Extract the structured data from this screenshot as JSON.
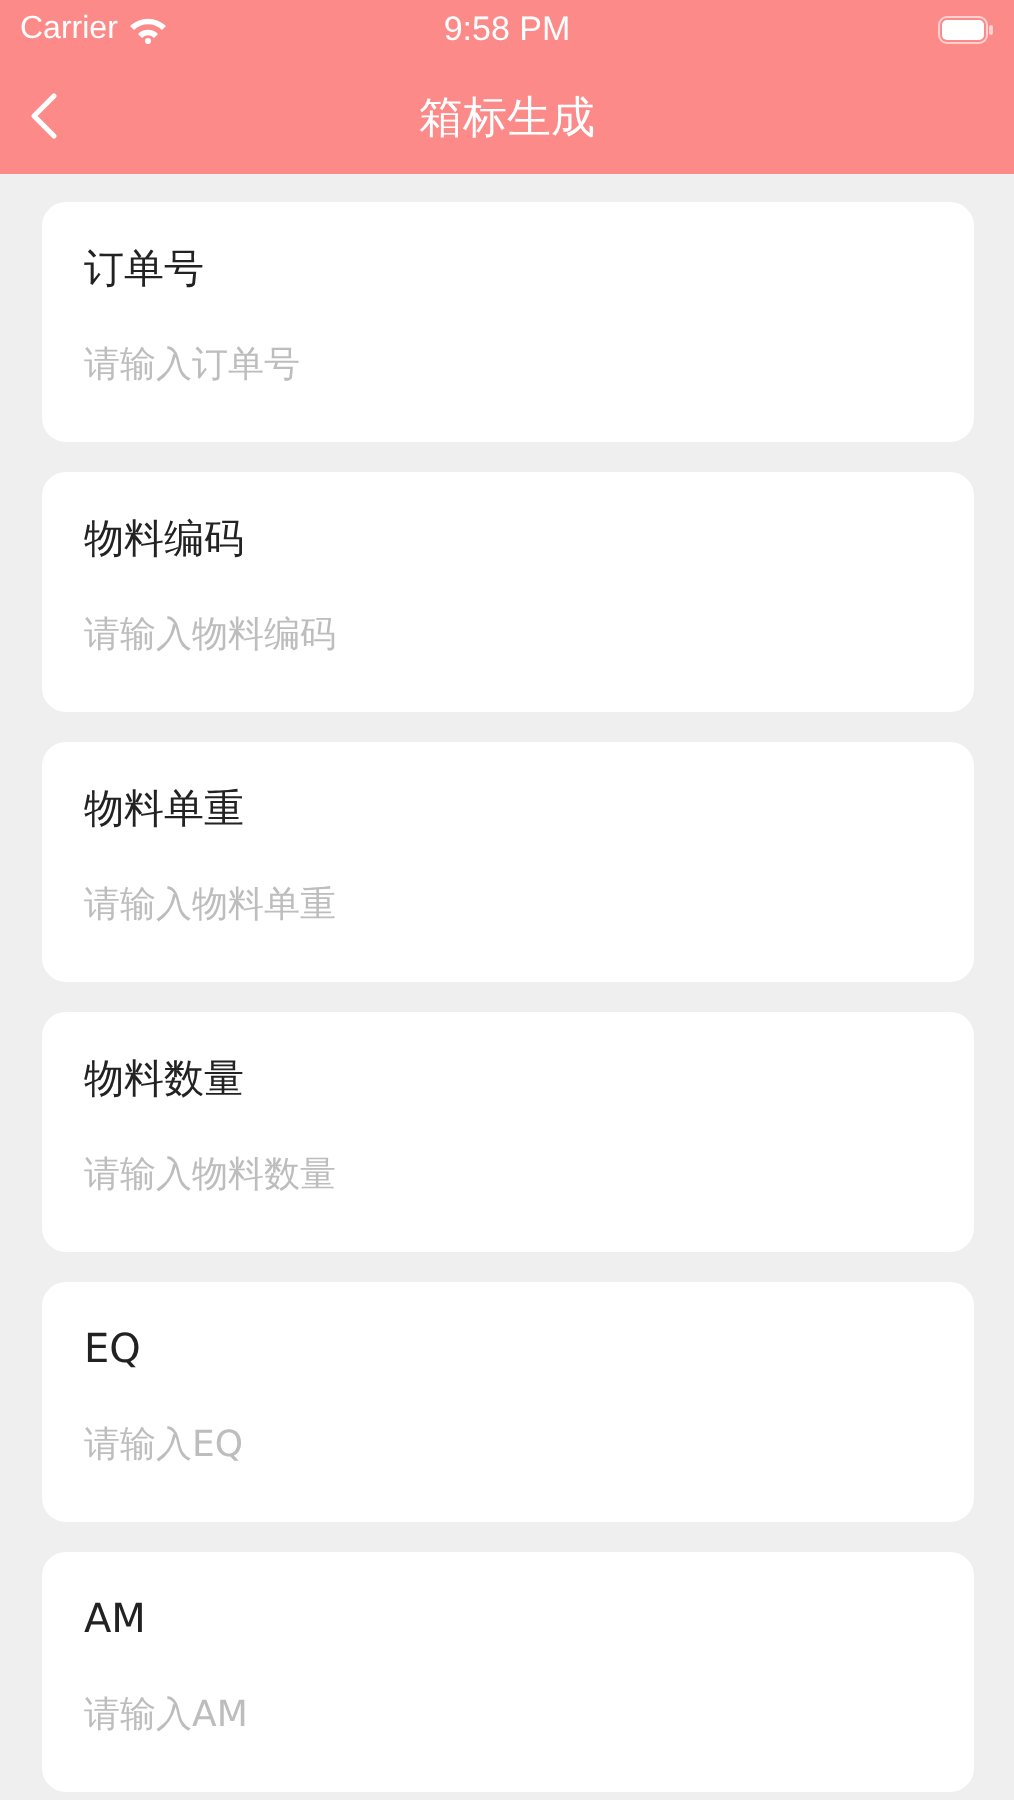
{
  "status_bar": {
    "carrier": "Carrier",
    "time": "9:58 PM"
  },
  "nav_bar": {
    "title": "箱标生成"
  },
  "fields": [
    {
      "label": "订单号",
      "placeholder": "请输入订单号"
    },
    {
      "label": "物料编码",
      "placeholder": "请输入物料编码"
    },
    {
      "label": "物料单重",
      "placeholder": "请输入物料单重"
    },
    {
      "label": "物料数量",
      "placeholder": "请输入物料数量"
    },
    {
      "label": "EQ",
      "placeholder": "请输入EQ"
    },
    {
      "label": "AM",
      "placeholder": "请输入AM"
    }
  ]
}
